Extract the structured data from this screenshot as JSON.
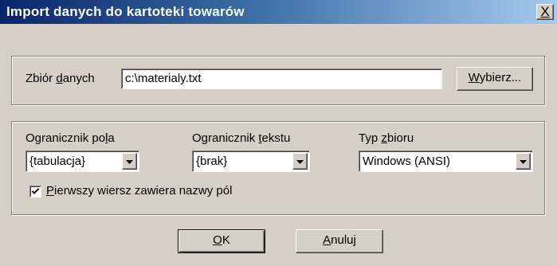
{
  "window": {
    "title": "Import danych do kartoteki towarów",
    "close_glyph": "X"
  },
  "dataset": {
    "label_pre": "Zbiór ",
    "label_accel": "d",
    "label_post": "anych",
    "value": "c:\\materialy.txt",
    "browse_accel": "W",
    "browse_rest": "ybierz..."
  },
  "options": {
    "field_delim": {
      "label_pre": "Ogranicznik po",
      "label_accel": "l",
      "label_post": "a",
      "value": "{tabulacja}"
    },
    "text_delim": {
      "label_pre": "Ogranicznik ",
      "label_accel": "t",
      "label_post": "ekstu",
      "value": "{brak}"
    },
    "file_type": {
      "label_pre": "Typ ",
      "label_accel": "z",
      "label_post": "bioru",
      "value": "Windows (ANSI)"
    },
    "header_row": {
      "checked": true,
      "label_accel": "P",
      "label_rest": "ierwszy wiersz zawiera nazwy pól"
    }
  },
  "buttons": {
    "ok_accel": "O",
    "ok_rest": "K",
    "cancel_accel": "A",
    "cancel_rest": "nuluj"
  }
}
